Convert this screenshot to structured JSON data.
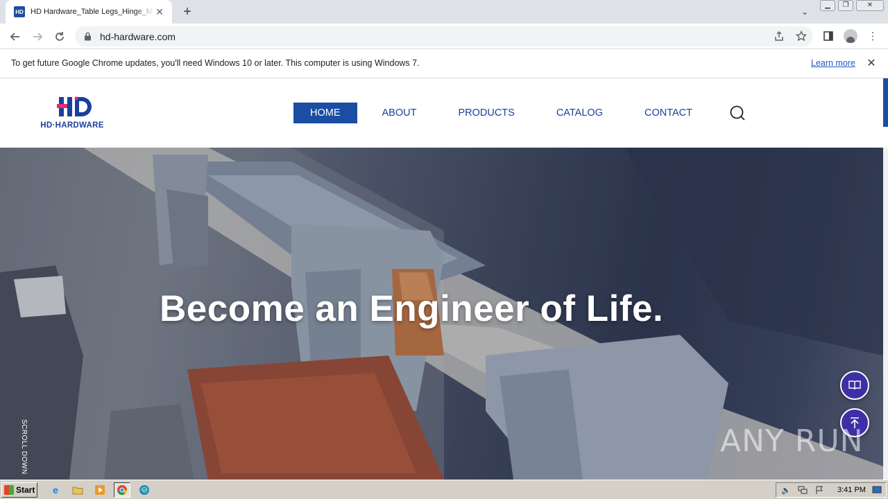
{
  "browser": {
    "tab_title": "HD Hardware_Table Legs_Hinge_Metal",
    "tab_favicon_text": "HD",
    "url": "hd-hardware.com",
    "icons": {
      "back": "arrow-left",
      "forward": "arrow-right",
      "reload": "reload",
      "lock": "lock",
      "share": "share",
      "bookmark": "star",
      "side_panel": "side-panel",
      "profile": "profile",
      "menu": "kebab-menu"
    }
  },
  "infobar": {
    "message": "To get future Google Chrome updates, you'll need Windows 10 or later. This computer is using Windows 7.",
    "link": "Learn more"
  },
  "site": {
    "logo_text": "HD·HARDWARE",
    "nav": [
      {
        "label": "HOME",
        "active": true
      },
      {
        "label": "ABOUT",
        "active": false
      },
      {
        "label": "PRODUCTS",
        "active": false
      },
      {
        "label": "CATALOG",
        "active": false
      },
      {
        "label": "CONTACT",
        "active": false
      }
    ],
    "hero_title": "Become an Engineer of Life.",
    "scroll_hint": "SCROLL DOWN",
    "colors": {
      "brand": "#1b4ea3",
      "accent": "#e8287a",
      "float_button": "#3f2fa6"
    }
  },
  "watermark": "ANY RUN",
  "taskbar": {
    "start_label": "Start",
    "clock": "3:41 PM"
  }
}
